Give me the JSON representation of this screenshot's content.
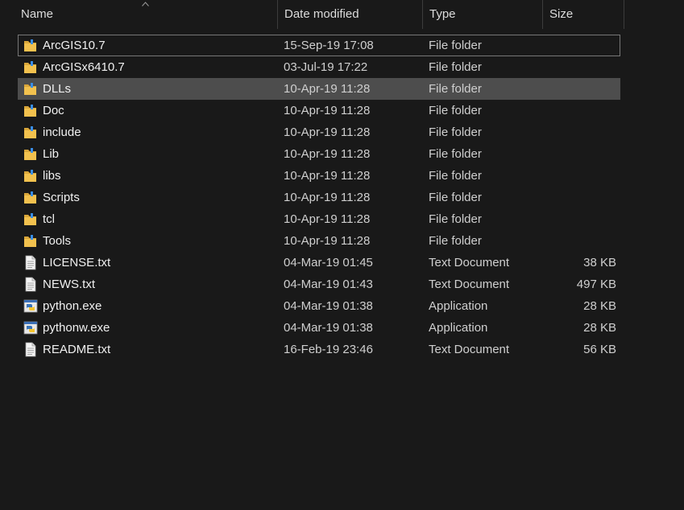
{
  "columns": {
    "name": "Name",
    "date": "Date modified",
    "type": "Type",
    "size": "Size"
  },
  "files": [
    {
      "name": "ArcGIS10.7",
      "date": "15-Sep-19 17:08",
      "type": "File folder",
      "size": "",
      "icon": "folder-icon",
      "state": "focused"
    },
    {
      "name": "ArcGISx6410.7",
      "date": "03-Jul-19 17:22",
      "type": "File folder",
      "size": "",
      "icon": "folder-icon",
      "state": ""
    },
    {
      "name": "DLLs",
      "date": "10-Apr-19 11:28",
      "type": "File folder",
      "size": "",
      "icon": "folder-icon",
      "state": "selected"
    },
    {
      "name": "Doc",
      "date": "10-Apr-19 11:28",
      "type": "File folder",
      "size": "",
      "icon": "folder-icon",
      "state": ""
    },
    {
      "name": "include",
      "date": "10-Apr-19 11:28",
      "type": "File folder",
      "size": "",
      "icon": "folder-icon",
      "state": ""
    },
    {
      "name": "Lib",
      "date": "10-Apr-19 11:28",
      "type": "File folder",
      "size": "",
      "icon": "folder-icon",
      "state": ""
    },
    {
      "name": "libs",
      "date": "10-Apr-19 11:28",
      "type": "File folder",
      "size": "",
      "icon": "folder-icon",
      "state": ""
    },
    {
      "name": "Scripts",
      "date": "10-Apr-19 11:28",
      "type": "File folder",
      "size": "",
      "icon": "folder-icon",
      "state": ""
    },
    {
      "name": "tcl",
      "date": "10-Apr-19 11:28",
      "type": "File folder",
      "size": "",
      "icon": "folder-icon",
      "state": ""
    },
    {
      "name": "Tools",
      "date": "10-Apr-19 11:28",
      "type": "File folder",
      "size": "",
      "icon": "folder-icon",
      "state": ""
    },
    {
      "name": "LICENSE.txt",
      "date": "04-Mar-19 01:45",
      "type": "Text Document",
      "size": "38 KB",
      "icon": "text-document-icon",
      "state": ""
    },
    {
      "name": "NEWS.txt",
      "date": "04-Mar-19 01:43",
      "type": "Text Document",
      "size": "497 KB",
      "icon": "text-document-icon",
      "state": ""
    },
    {
      "name": "python.exe",
      "date": "04-Mar-19 01:38",
      "type": "Application",
      "size": "28 KB",
      "icon": "python-app-icon",
      "state": ""
    },
    {
      "name": "pythonw.exe",
      "date": "04-Mar-19 01:38",
      "type": "Application",
      "size": "28 KB",
      "icon": "python-app-icon",
      "state": ""
    },
    {
      "name": "README.txt",
      "date": "16-Feb-19 23:46",
      "type": "Text Document",
      "size": "56 KB",
      "icon": "text-document-icon",
      "state": ""
    }
  ],
  "colors": {
    "background": "#191919",
    "selected_row": "#4d4d4d",
    "focus_border": "#777777",
    "folder": "#f2c14e"
  }
}
